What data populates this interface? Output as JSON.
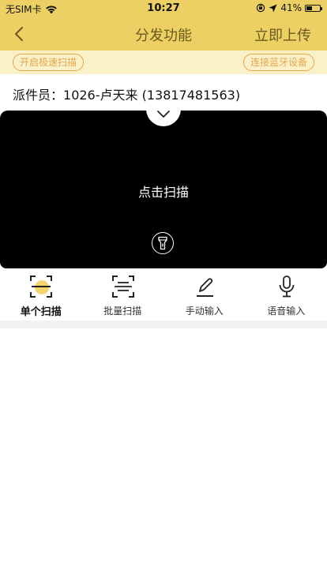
{
  "status_bar": {
    "carrier": "无SIM卡",
    "time": "10:27",
    "battery_percent": "41%",
    "battery_level": 0.41
  },
  "nav": {
    "title": "分发功能",
    "action": "立即上传"
  },
  "options": {
    "fast_scan": "开启极速扫描",
    "bluetooth": "连接蓝牙设备"
  },
  "courier": {
    "label": "派件员：",
    "value": "1026-卢天来 (13817481563)"
  },
  "scanner": {
    "prompt": "点击扫描"
  },
  "modes": [
    {
      "label": "单个扫描",
      "icon": "single-scan-icon",
      "active": true
    },
    {
      "label": "批量扫描",
      "icon": "batch-scan-icon",
      "active": false
    },
    {
      "label": "手动输入",
      "icon": "pen-icon",
      "active": false
    },
    {
      "label": "语音输入",
      "icon": "microphone-icon",
      "active": false
    }
  ],
  "colors": {
    "header": "#ecd063",
    "option_bar": "#fbf1c9",
    "pill": "#e5a74a",
    "title_text": "#6b5a1e",
    "accent_yellow": "#f2d56b"
  }
}
